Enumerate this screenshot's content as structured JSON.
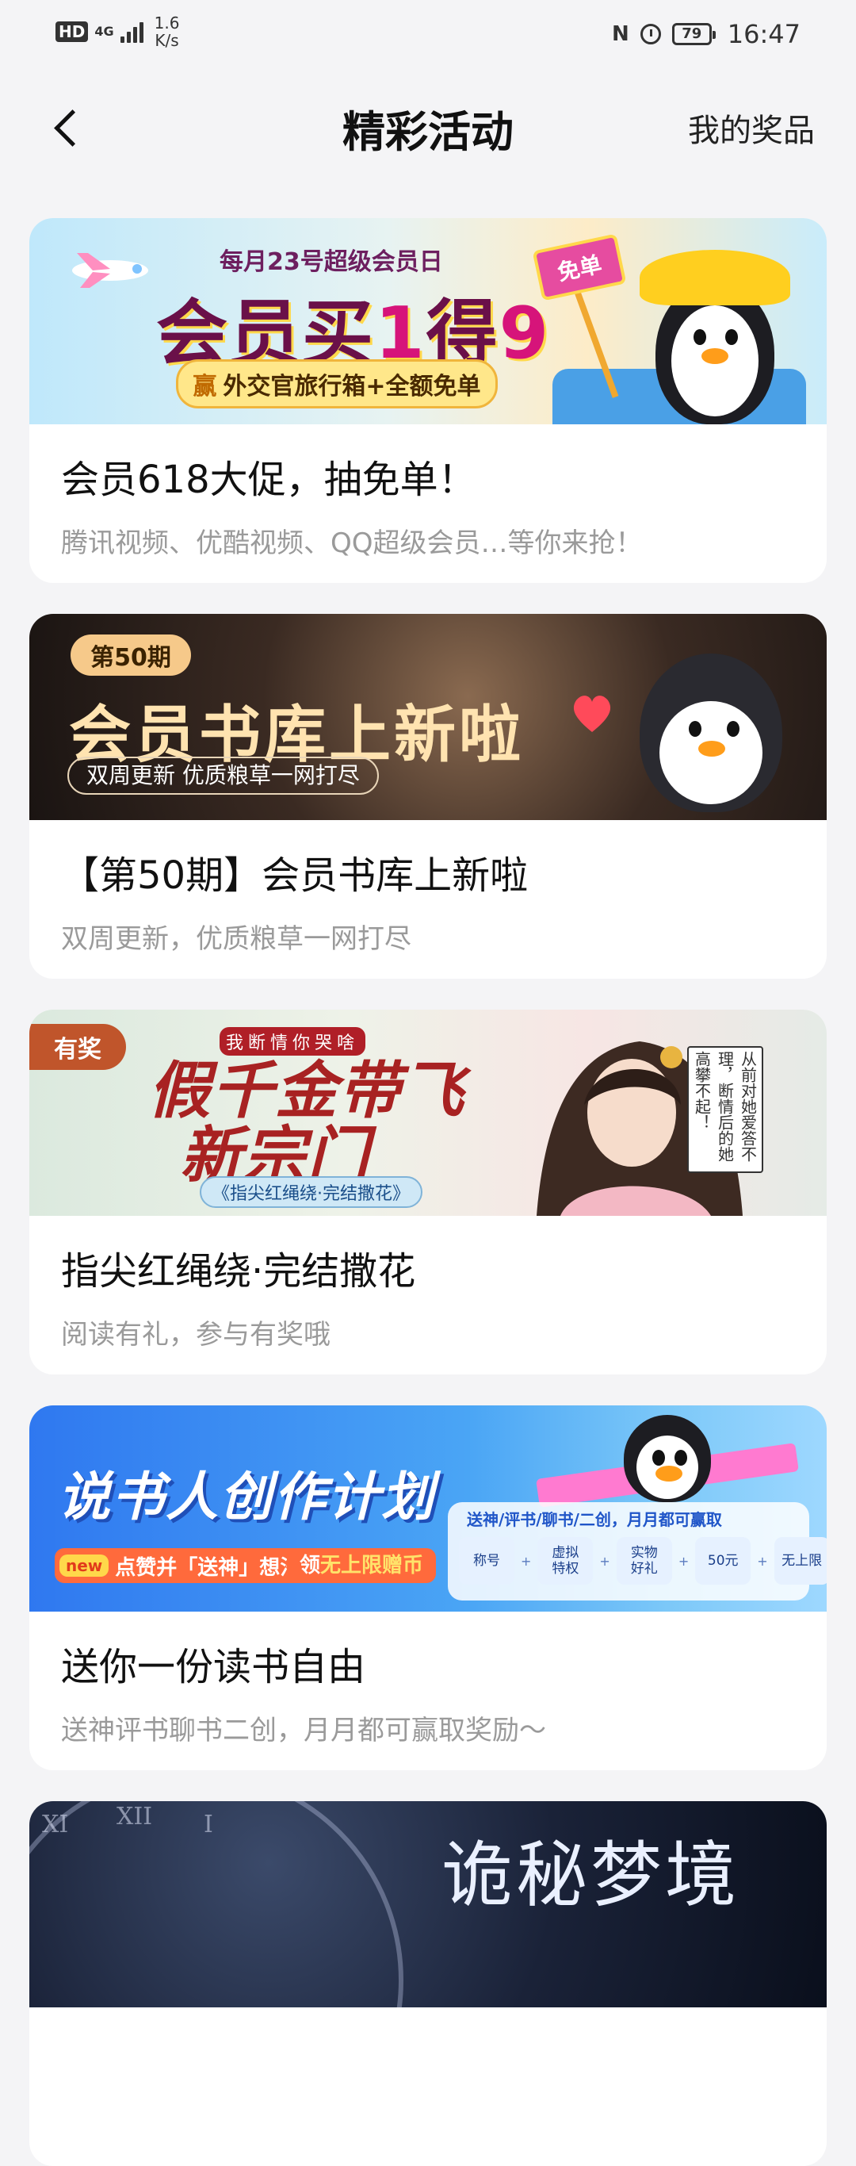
{
  "status_bar": {
    "hd": "HD",
    "network": "4G",
    "speed_value": "1.6",
    "speed_unit": "K/s",
    "nfc": "N",
    "battery": "79",
    "time": "16:47"
  },
  "nav": {
    "title": "精彩活动",
    "right_link": "我的奖品"
  },
  "cards": [
    {
      "title": "会员618大促，抽免单！",
      "subtitle": "腾讯视频、优酷视频、QQ超级会员…等你来抢！",
      "banner": {
        "top_text": "每月23号超级会员日",
        "main_pre": "会员买",
        "main_num1": "1",
        "main_mid": "得",
        "main_num2": "9",
        "pill_prefix": "赢",
        "pill_text": "外交官旅行箱+全额免单",
        "sign": "免单"
      }
    },
    {
      "title": "【第50期】会员书库上新啦",
      "subtitle": "双周更新，优质粮草一网打尽",
      "banner": {
        "tag": "第50期",
        "main": "会员书库上新啦",
        "pill": "双周更新  优质粮草一网打尽"
      }
    },
    {
      "title": "指尖红绳绕·完结撒花",
      "subtitle": "阅读有礼，参与有奖哦",
      "banner": {
        "badge": "有奖",
        "small": "我断情你哭啥",
        "main_line1": "假千金带飞",
        "main_line2": "新宗门",
        "sub": "《指尖红绳绕·完结撒花》",
        "scroll": "从前对她爱答不理，断情后的她高攀不起！"
      }
    },
    {
      "title": "送你一份读书自由",
      "subtitle": "送神评书聊书二创，月月都可赢取奖励～",
      "banner": {
        "main": "说书人创作计划",
        "new_tag": "new",
        "pill1": "点赞并「送神」想法",
        "pill2_prefix": "领",
        "pill2_bold": "无上限赠币",
        "panel_title": "送神/评书/聊书/二创，月月都可赢取",
        "chips": [
          "称号",
          "虚拟\n特权",
          "实物\n好礼",
          "50元",
          "无上限"
        ]
      }
    },
    {
      "banner": {
        "main": "诡秘梦境",
        "roman": [
          "XI",
          "XII",
          "I"
        ]
      }
    }
  ]
}
